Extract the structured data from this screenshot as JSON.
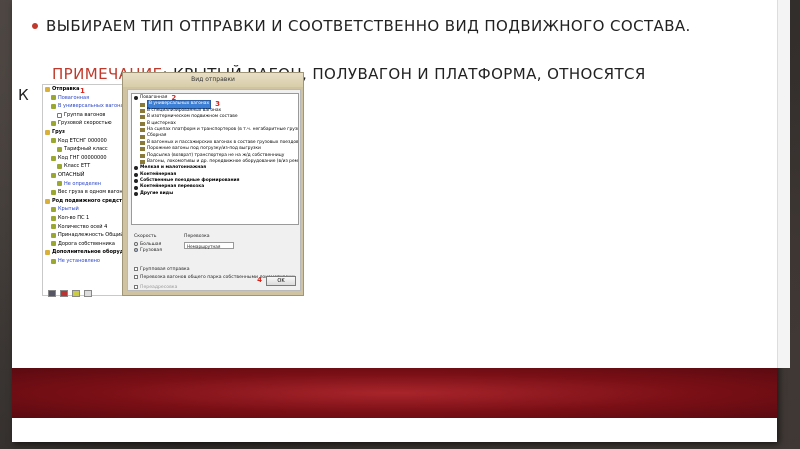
{
  "slide": {
    "bullet_text": "Выбираем тип отправки и соответственно вид подвижного состава.",
    "note_label": "Примечание:",
    "note_text": " крытый вагон, полувагон и платформа, относятся",
    "note_cont": "к"
  },
  "dialog": {
    "title": "Вид отправки",
    "items": [
      {
        "text": "Повагонная",
        "level": 0,
        "bold": false,
        "marker": "2"
      },
      {
        "text": "В универсальных вагонах",
        "level": 1,
        "selected": true,
        "marker": "3"
      },
      {
        "text": "В специализированных вагонах",
        "level": 1
      },
      {
        "text": "В изотермическом подвижном составе",
        "level": 1
      },
      {
        "text": "В цистернах",
        "level": 1
      },
      {
        "text": "На сцепах платформ и транспортеров (в т.ч. негабаритные грузы)",
        "level": 1
      },
      {
        "text": "Сборная",
        "level": 1
      },
      {
        "text": "В вагонных и пассажирских вагонах в составе грузовых поездов",
        "level": 1
      },
      {
        "text": "Порожние вагоны под погрузку/из-под выгрузки",
        "level": 1
      },
      {
        "text": "Подсылка (возврат) транспортера не на ж/д собственницу",
        "level": 1
      },
      {
        "text": "Вагоны, локомотивы и др. передвижное оборудование (в/из ремонта)",
        "level": 1
      },
      {
        "text": "Мелкая и малотоннажная",
        "level": 0,
        "bold": true
      },
      {
        "text": "Контейнерная",
        "level": 0,
        "bold": true
      },
      {
        "text": "Собственные поездные формирования",
        "level": 0,
        "bold": true
      },
      {
        "text": "Контейнерная перевозка",
        "level": 0,
        "bold": true
      },
      {
        "text": "Другие виды",
        "level": 0,
        "bold": true
      }
    ],
    "speed_label": "Скорость",
    "speed_options": [
      {
        "label": "Большая",
        "checked": false
      },
      {
        "label": "Грузовая",
        "checked": true
      }
    ],
    "per_label": "Перевозка",
    "per_value": "Немаршрутная",
    "checkboxes": [
      {
        "label": "Групповая отправка",
        "checked": false,
        "disabled": false
      },
      {
        "label": "Перевозка вагонов общего парка собственными локомотивами",
        "checked": false,
        "disabled": false
      },
      {
        "label": "Переадресовка",
        "checked": false,
        "disabled": true
      }
    ],
    "ok_label": "OK",
    "marker_4": "4"
  },
  "tree": {
    "marker_1": "1",
    "rows": [
      {
        "text": "Отправка",
        "bold": true,
        "icon": "folder"
      },
      {
        "text": "Повагонная",
        "blue": true,
        "indent": 1
      },
      {
        "text": "В универсальных вагонах",
        "blue": true,
        "indent": 1
      },
      {
        "text": "Группа вагонов",
        "indent": 2,
        "icon": "box"
      },
      {
        "text": "Грузовой скоростью",
        "indent": 1
      },
      {
        "text": "Груз",
        "bold": true,
        "icon": "folder"
      },
      {
        "text": "Код ЕТСНГ 000000",
        "indent": 1,
        "blue_tail": true
      },
      {
        "text": "Тарифный класс",
        "indent": 2
      },
      {
        "text": "Код ГНГ 00000000",
        "indent": 1
      },
      {
        "text": "Класс ЕТТ",
        "indent": 2
      },
      {
        "text": "ОПАСНЫЙ",
        "indent": 1
      },
      {
        "text": "Не определен",
        "blue": true,
        "indent": 2
      },
      {
        "text": "Вес груза в одном вагоне",
        "indent": 1
      },
      {
        "text": "Род подвижного средства",
        "bold": true,
        "icon": "folder"
      },
      {
        "text": "Крытый",
        "blue": true,
        "indent": 1
      },
      {
        "text": "Кол-во ПС 1",
        "indent": 1
      },
      {
        "text": "Количество осей 4",
        "indent": 1
      },
      {
        "text": "Принадлежность Общий",
        "indent": 1
      },
      {
        "text": "Дорога собственника",
        "indent": 1
      },
      {
        "text": "Дополнительное оборудование",
        "bold": true,
        "icon": "folder"
      },
      {
        "text": "Не установлено",
        "blue": true,
        "indent": 1
      }
    ]
  }
}
